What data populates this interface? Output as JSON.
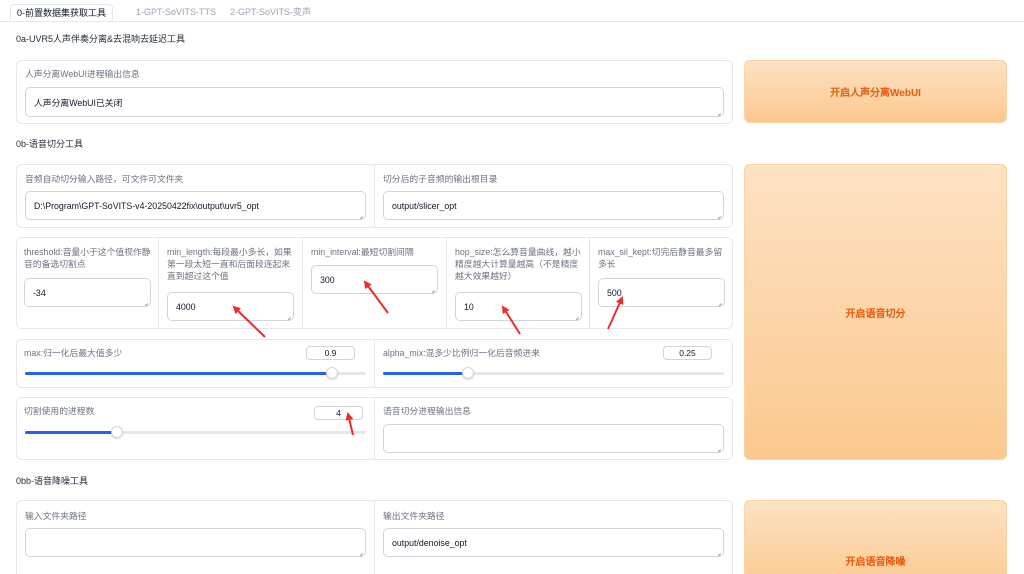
{
  "tabs": [
    {
      "label": "0-前置数据集获取工具"
    },
    {
      "label": "1-GPT-SoVITS-TTS"
    },
    {
      "label": "2-GPT-SoVITS-变声"
    }
  ],
  "uvr5": {
    "title": "0a-UVR5人声伴奏分离&去混响去延迟工具",
    "info_label": "人声分离WebUI进程输出信息",
    "info_value": "人声分离WebUI已关闭",
    "button": "开启人声分离WebUI"
  },
  "slicer": {
    "title": "0b-语音切分工具",
    "input_path_label": "音频自动切分输入路径，可文件可文件夹",
    "input_path_value": "D:\\Program\\GPT-SoVITS-v4-20250422fix\\output\\uvr5_opt",
    "output_dir_label": "切分后的子音频的输出根目录",
    "output_dir_value": "output/slicer_opt",
    "threshold_label": "threshold:音量小于这个值视作静音的备选切割点",
    "threshold_value": "-34",
    "min_length_label": "min_length:每段最小多长，如果第一段太短一直和后面段连起来直到超过这个值",
    "min_length_value": "4000",
    "min_interval_label": "min_interval:最短切割间隔",
    "min_interval_value": "300",
    "hop_size_label": "hop_size:怎么算音量曲线，越小精度越大计算量越高（不是精度越大效果越好）",
    "hop_size_value": "10",
    "max_sil_kept_label": "max_sil_kept:切完后静音最多留多长",
    "max_sil_kept_value": "500",
    "max_label": "max:归一化后最大值多少",
    "max_value": "0.9",
    "max_fraction": 0.9,
    "alpha_label": "alpha_mix:混多少比例归一化后音频进来",
    "alpha_value": "0.25",
    "alpha_fraction": 0.25,
    "process_label": "切割使用的进程数",
    "process_value": "4",
    "process_fraction": 0.27,
    "output_info_label": "语音切分进程输出信息",
    "output_info_value": "",
    "button": "开启语音切分"
  },
  "denoise": {
    "title": "0bb-语音降噪工具",
    "input_label": "输入文件夹路径",
    "input_value": "",
    "output_label": "输出文件夹路径",
    "output_value": "output/denoise_opt",
    "button": "开启语音降噪"
  },
  "colors": {
    "accent": "#2563eb",
    "button_text": "#ea580c",
    "annotation_arrow": "#ef2b2b"
  },
  "icons": [
    "resize-grip-icon",
    "red-arrow-annotation"
  ]
}
